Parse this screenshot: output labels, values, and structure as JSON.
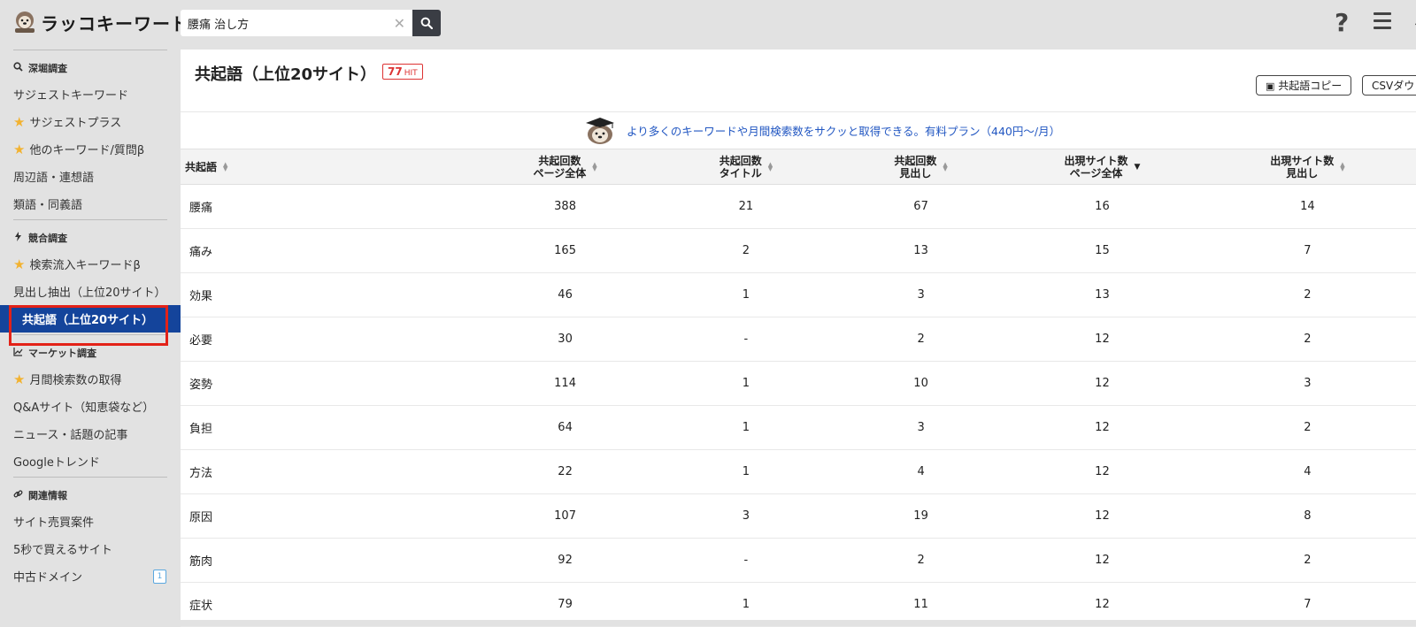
{
  "app": {
    "name": "ラッコキーワード"
  },
  "search": {
    "value": "腰痛 治し方"
  },
  "sidebar": {
    "sections": [
      {
        "heading": "深堀調査",
        "icon": "search-icon",
        "items": [
          {
            "label": "サジェストキーワード",
            "star": false
          },
          {
            "label": "サジェストプラス",
            "star": true
          },
          {
            "label": "他のキーワード/質問β",
            "star": true
          },
          {
            "label": "周辺語・連想語",
            "star": false
          },
          {
            "label": "類語・同義語",
            "star": false
          }
        ]
      },
      {
        "heading": "競合調査",
        "icon": "bolt-icon",
        "items": [
          {
            "label": "検索流入キーワードβ",
            "star": true
          },
          {
            "label": "見出し抽出（上位20サイト）",
            "star": false
          },
          {
            "label": "共起語（上位20サイト）",
            "star": false,
            "active": true
          }
        ]
      },
      {
        "heading": "マーケット調査",
        "icon": "chart-icon",
        "items": [
          {
            "label": "月間検索数の取得",
            "star": true
          },
          {
            "label": "Q&Aサイト（知恵袋など）",
            "star": false
          },
          {
            "label": "ニュース・話題の記事",
            "star": false
          },
          {
            "label": "Googleトレンド",
            "star": false
          }
        ]
      },
      {
        "heading": "関連情報",
        "icon": "link-icon",
        "items": [
          {
            "label": "サイト売買案件",
            "star": false
          },
          {
            "label": "5秒で買えるサイト",
            "star": false
          },
          {
            "label": "中古ドメイン",
            "star": false,
            "badge": "1"
          }
        ]
      }
    ]
  },
  "main": {
    "title": "共起語（上位20サイト）",
    "hit_count": "77",
    "hit_label": "HIT",
    "copy_button": "共起語コピー",
    "csv_button": "CSVダウン",
    "promo_text": "より多くのキーワードや月間検索数をサクッと取得できる。有料プラン（440円〜/月）"
  },
  "table": {
    "headers": [
      {
        "line1": "共起語",
        "line2": ""
      },
      {
        "line1": "共起回数",
        "line2": "ページ全体"
      },
      {
        "line1": "共起回数",
        "line2": "タイトル"
      },
      {
        "line1": "共起回数",
        "line2": "見出し"
      },
      {
        "line1": "出現サイト数",
        "line2": "ページ全体"
      },
      {
        "line1": "出現サイト数",
        "line2": "見出し"
      }
    ],
    "sort_column": 4,
    "rows": [
      [
        "腰痛",
        "388",
        "21",
        "67",
        "16",
        "14"
      ],
      [
        "痛み",
        "165",
        "2",
        "13",
        "15",
        "7"
      ],
      [
        "効果",
        "46",
        "1",
        "3",
        "13",
        "2"
      ],
      [
        "必要",
        "30",
        "-",
        "2",
        "12",
        "2"
      ],
      [
        "姿勢",
        "114",
        "1",
        "10",
        "12",
        "3"
      ],
      [
        "負担",
        "64",
        "1",
        "3",
        "12",
        "2"
      ],
      [
        "方法",
        "22",
        "1",
        "4",
        "12",
        "4"
      ],
      [
        "原因",
        "107",
        "3",
        "19",
        "12",
        "8"
      ],
      [
        "筋肉",
        "92",
        "-",
        "2",
        "12",
        "2"
      ],
      [
        "症状",
        "79",
        "1",
        "11",
        "12",
        "7"
      ]
    ]
  },
  "colors": {
    "accent": "#14449b",
    "highlight": "#e32218",
    "link": "#2257c2",
    "star": "#f2b230"
  }
}
